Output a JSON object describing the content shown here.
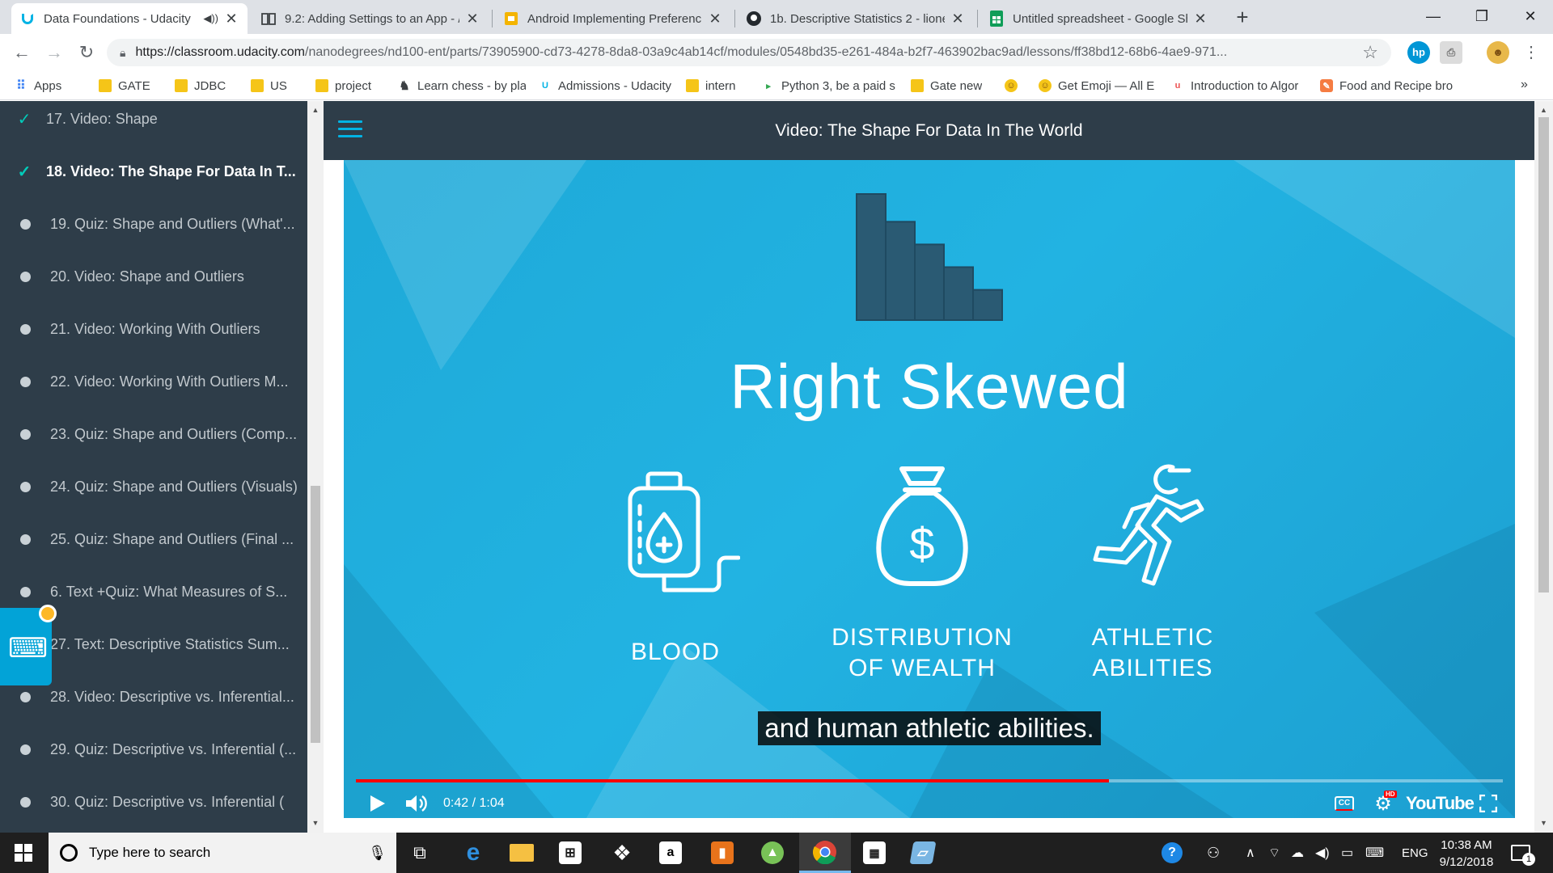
{
  "browser": {
    "tabs": [
      {
        "title": "Data Foundations - Udacity",
        "icon": "udacity-icon",
        "active": true,
        "audio": true
      },
      {
        "title": "9.2: Adding Settings to an App - /",
        "icon": "book-icon",
        "active": false
      },
      {
        "title": "Android Implementing Preferenc",
        "icon": "slides-icon",
        "active": false
      },
      {
        "title": "1b. Descriptive Statistics 2 - lionel",
        "icon": "github-icon",
        "active": false
      },
      {
        "title": "Untitled spreadsheet - Google Sh",
        "icon": "sheets-icon",
        "active": false
      }
    ],
    "url_host": "https://classroom.udacity.com",
    "url_path": "/nanodegrees/nd100-ent/parts/73905900-cd73-4278-8da8-03a9c4ab14cf/modules/0548bd35-e261-484a-b2f7-463902bac9ad/lessons/ff38bd12-68b6-4ae9-971...",
    "bookmarks": [
      {
        "label": "Apps",
        "icon": "apps-grid-icon"
      },
      {
        "label": "GATE",
        "icon": "folder-icon"
      },
      {
        "label": "JDBC",
        "icon": "folder-icon"
      },
      {
        "label": "US",
        "icon": "folder-icon"
      },
      {
        "label": "project",
        "icon": "folder-icon"
      },
      {
        "label": "Learn chess - by play",
        "icon": "chess-icon"
      },
      {
        "label": "Admissions - Udacity",
        "icon": "udacity-icon"
      },
      {
        "label": "intern",
        "icon": "folder-icon"
      },
      {
        "label": "Python 3, be a paid s",
        "icon": "python-icon"
      },
      {
        "label": "Gate new",
        "icon": "folder-icon"
      },
      {
        "label": "",
        "icon": "emoji-icon"
      },
      {
        "label": "Get Emoji — All E",
        "icon": "emoji-icon"
      },
      {
        "label": "Introduction to Algor",
        "icon": "udemy-icon"
      },
      {
        "label": "Food and Recipe bro",
        "icon": "recipe-icon"
      }
    ],
    "more": "»"
  },
  "sidebar": {
    "items": [
      {
        "label": "17. Video: Shape",
        "state": "done"
      },
      {
        "label": "18. Video: The Shape For Data In T...",
        "state": "current"
      },
      {
        "label": "19. Quiz: Shape and Outliers (What'...",
        "state": "todo"
      },
      {
        "label": "20. Video: Shape and Outliers",
        "state": "todo"
      },
      {
        "label": "21. Video: Working With Outliers",
        "state": "todo"
      },
      {
        "label": "22. Video: Working With Outliers M...",
        "state": "todo"
      },
      {
        "label": "23. Quiz: Shape and Outliers (Comp...",
        "state": "todo"
      },
      {
        "label": "24. Quiz: Shape and Outliers (Visuals)",
        "state": "todo"
      },
      {
        "label": "25. Quiz: Shape and Outliers (Final ...",
        "state": "todo"
      },
      {
        "label": "6. Text +Quiz: What Measures of S...",
        "state": "todo"
      },
      {
        "label": "27. Text: Descriptive Statistics Sum...",
        "state": "todo"
      },
      {
        "label": "28. Video: Descriptive vs. Inferential...",
        "state": "todo"
      },
      {
        "label": "29. Quiz: Descriptive vs. Inferential (...",
        "state": "todo"
      },
      {
        "label": "30. Quiz: Descriptive vs. Inferential (",
        "state": "todo"
      }
    ]
  },
  "content": {
    "title": "Video: The Shape For Data In The World"
  },
  "video": {
    "heading": "Right Skewed",
    "histogram_levels": [
      1.0,
      0.78,
      0.6,
      0.42,
      0.24
    ],
    "categories": [
      {
        "line1": "BLOOD",
        "line2": "",
        "icon": "blood-bag-icon"
      },
      {
        "line1": "DISTRIBUTION",
        "line2": "OF WEALTH",
        "icon": "money-bag-icon"
      },
      {
        "line1": "ATHLETIC",
        "line2": "ABILITIES",
        "icon": "runner-icon"
      }
    ],
    "caption": "and human athletic abilities.",
    "time": "0:42 / 1:04",
    "progress_fraction": 0.6563,
    "brand": "YouTube",
    "cc": "CC",
    "hd": "HD"
  },
  "taskbar": {
    "search_placeholder": "Type here to search",
    "apps": [
      "task-view-icon",
      "edge-icon",
      "file-explorer-icon",
      "store-icon",
      "dropbox-icon",
      "amazon-icon",
      "office-icon",
      "android-studio-icon",
      "chrome-icon",
      "calculator-icon",
      "notes-icon"
    ],
    "language": "ENG",
    "time": "10:38 AM",
    "date": "9/12/2018",
    "notifications": "1"
  },
  "colors": {
    "sidebar_bg": "#2e3d49",
    "check": "#02ccba",
    "player_bg": "#1ea9d8",
    "histogram_bar": "#2a5a73",
    "progress": "#ff0000",
    "taskbar": "#1f1f1f"
  }
}
